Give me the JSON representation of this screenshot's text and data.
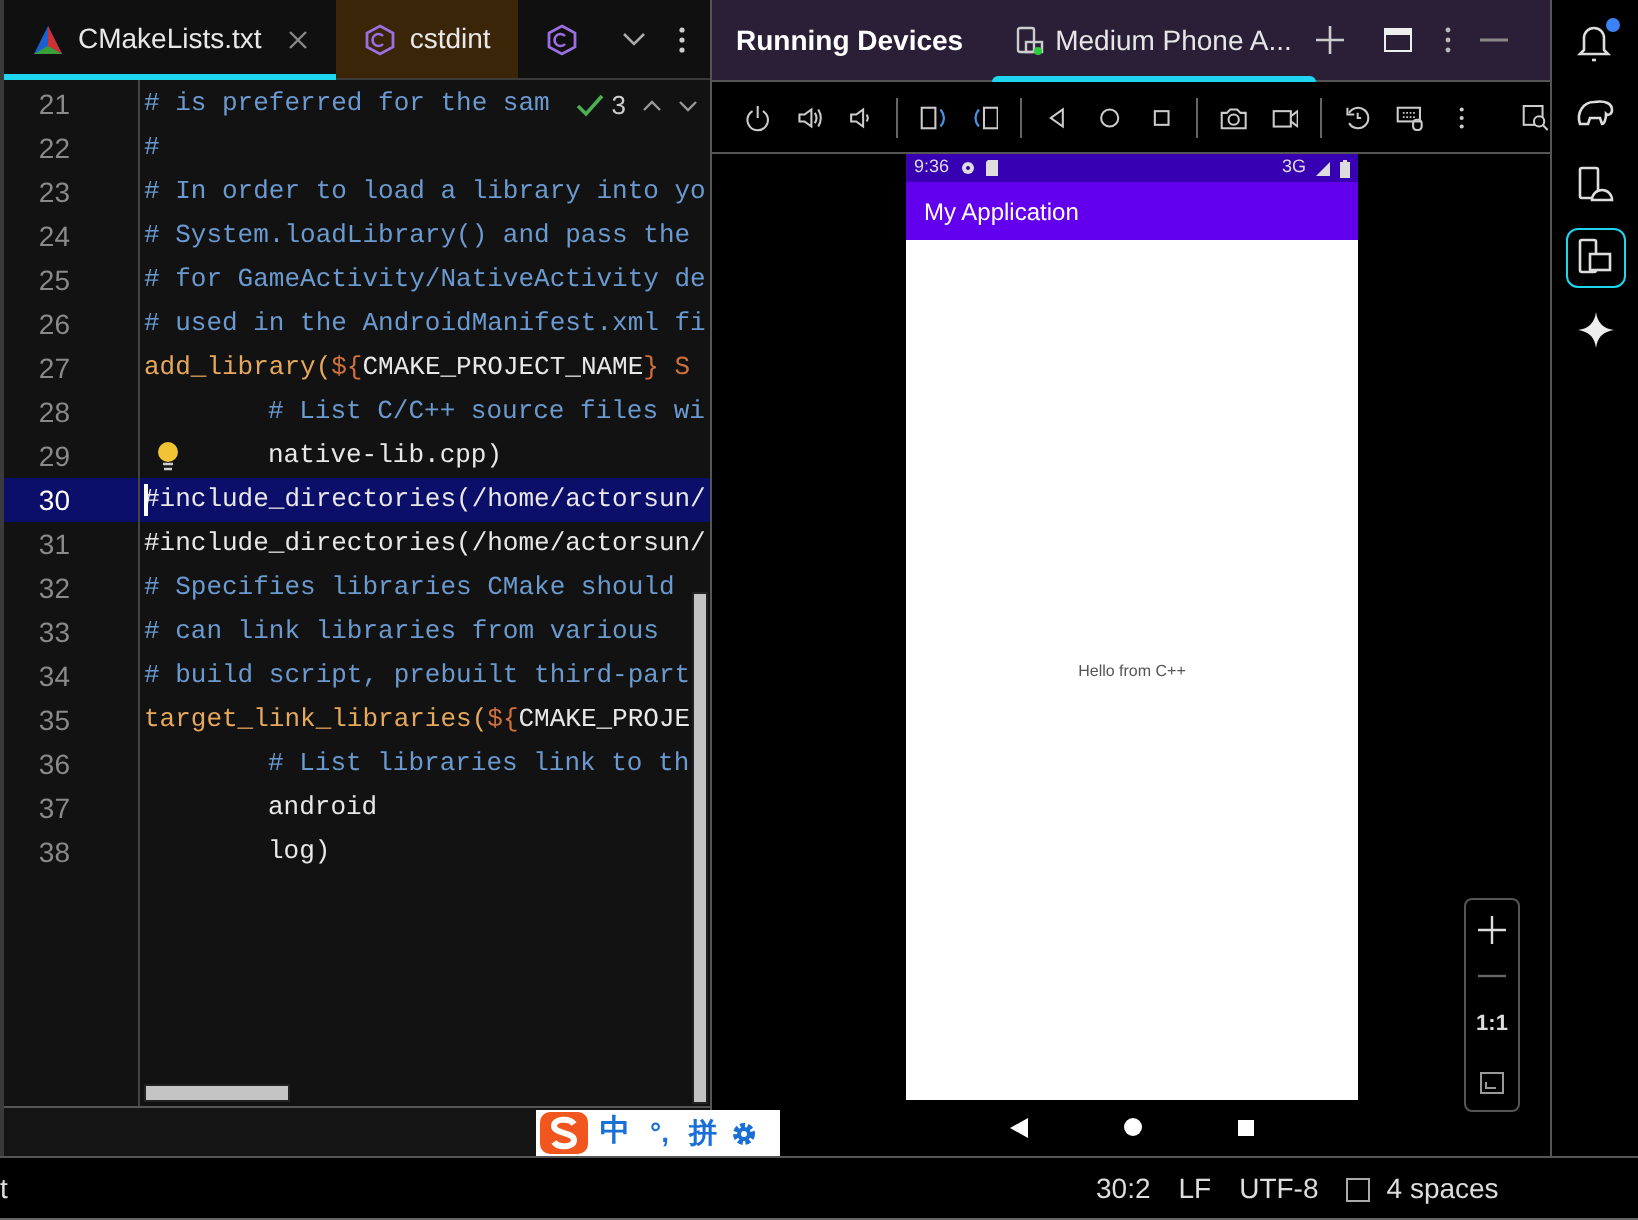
{
  "editor_tabs": [
    {
      "kind": "cmake",
      "label": "CMakeLists.txt",
      "selected": true
    },
    {
      "kind": "cpp",
      "label": "cstdint",
      "selected": false
    },
    {
      "kind": "cpp",
      "selected": false
    }
  ],
  "inspections": {
    "count": "3"
  },
  "code": {
    "lines": [
      {
        "number": "21",
        "selected": false,
        "bulb": false,
        "indented": false,
        "segments": [
          {
            "kind": "comment",
            "text": "# is preferred for the sam"
          }
        ]
      },
      {
        "number": "22",
        "selected": false,
        "bulb": false,
        "indented": false,
        "segments": [
          {
            "kind": "comment",
            "text": "#"
          }
        ]
      },
      {
        "number": "23",
        "selected": false,
        "bulb": false,
        "indented": false,
        "segments": [
          {
            "kind": "comment",
            "text": "# In order to load a library into yo"
          }
        ]
      },
      {
        "number": "24",
        "selected": false,
        "bulb": false,
        "indented": false,
        "segments": [
          {
            "kind": "comment",
            "text": "# System.loadLibrary() and pass the"
          }
        ]
      },
      {
        "number": "25",
        "selected": false,
        "bulb": false,
        "indented": false,
        "segments": [
          {
            "kind": "comment",
            "text": "# for GameActivity/NativeActivity de"
          }
        ]
      },
      {
        "number": "26",
        "selected": false,
        "bulb": false,
        "indented": false,
        "segments": [
          {
            "kind": "comment",
            "text": "# used in the AndroidManifest.xml fi"
          }
        ]
      },
      {
        "number": "27",
        "selected": false,
        "bulb": false,
        "indented": false,
        "segments": [
          {
            "kind": "func",
            "text": "add_library("
          },
          {
            "kind": "var",
            "text": "${"
          },
          {
            "kind": "plain",
            "text": "CMAKE_PROJECT_NAME"
          },
          {
            "kind": "var",
            "text": "} S"
          }
        ]
      },
      {
        "number": "28",
        "selected": false,
        "bulb": false,
        "indented": true,
        "segments": [
          {
            "kind": "comment",
            "text": "# List C/C++ source files wi"
          }
        ]
      },
      {
        "number": "29",
        "selected": false,
        "bulb": true,
        "indented": true,
        "segments": [
          {
            "kind": "plain",
            "text": "native-lib.cpp)"
          }
        ]
      },
      {
        "number": "30",
        "selected": true,
        "bulb": false,
        "indented": false,
        "segments": [
          {
            "kind": "plain",
            "text": "#include_directories(/home/actorsun/"
          }
        ]
      },
      {
        "number": "31",
        "selected": false,
        "bulb": false,
        "indented": false,
        "segments": [
          {
            "kind": "plain",
            "text": "#include_directories(/home/actorsun/"
          }
        ]
      },
      {
        "number": "32",
        "selected": false,
        "bulb": false,
        "indented": false,
        "segments": [
          {
            "kind": "comment",
            "text": "# Specifies libraries CMake should"
          }
        ]
      },
      {
        "number": "33",
        "selected": false,
        "bulb": false,
        "indented": false,
        "segments": [
          {
            "kind": "comment",
            "text": "# can link libraries from various"
          }
        ]
      },
      {
        "number": "34",
        "selected": false,
        "bulb": false,
        "indented": false,
        "segments": [
          {
            "kind": "comment",
            "text": "# build script, prebuilt third-part"
          }
        ]
      },
      {
        "number": "35",
        "selected": false,
        "bulb": false,
        "indented": false,
        "segments": [
          {
            "kind": "func",
            "text": "target_link_libraries("
          },
          {
            "kind": "var",
            "text": "${"
          },
          {
            "kind": "plain",
            "text": "CMAKE_PROJE"
          }
        ]
      },
      {
        "number": "36",
        "selected": false,
        "bulb": false,
        "indented": true,
        "segments": [
          {
            "kind": "comment",
            "text": "# List libraries link to th"
          }
        ]
      },
      {
        "number": "37",
        "selected": false,
        "bulb": false,
        "indented": true,
        "segments": [
          {
            "kind": "plain",
            "text": "android"
          }
        ]
      },
      {
        "number": "38",
        "selected": false,
        "bulb": false,
        "indented": true,
        "segments": [
          {
            "kind": "plain",
            "text": "log)"
          }
        ]
      }
    ]
  },
  "ime_bar": {
    "mode": "中",
    "punctuation": "°,",
    "scheme": "拼"
  },
  "running_devices": {
    "title": "Running Devices",
    "tabs": [
      {
        "label": "Medium Phone A...",
        "selected": true
      }
    ]
  },
  "phone": {
    "time": "9:36",
    "network": "3G",
    "app_title": "My Application",
    "message": "Hello from C++"
  },
  "zoom_controls": {
    "actual_size": "1:1"
  },
  "right_toolbar": [
    {
      "kind": "bell",
      "selected": false,
      "notification": true
    },
    {
      "kind": "elephant",
      "selected": false,
      "notification": false
    },
    {
      "kind": "device_manager",
      "selected": false,
      "notification": false
    },
    {
      "kind": "running_devices",
      "selected": true,
      "notification": false
    },
    {
      "kind": "sparkle",
      "selected": false,
      "notification": false
    }
  ],
  "status_bar": {
    "left": "t",
    "position": "30:2",
    "line_separator": "LF",
    "encoding": "UTF-8",
    "indent": "4 spaces"
  }
}
